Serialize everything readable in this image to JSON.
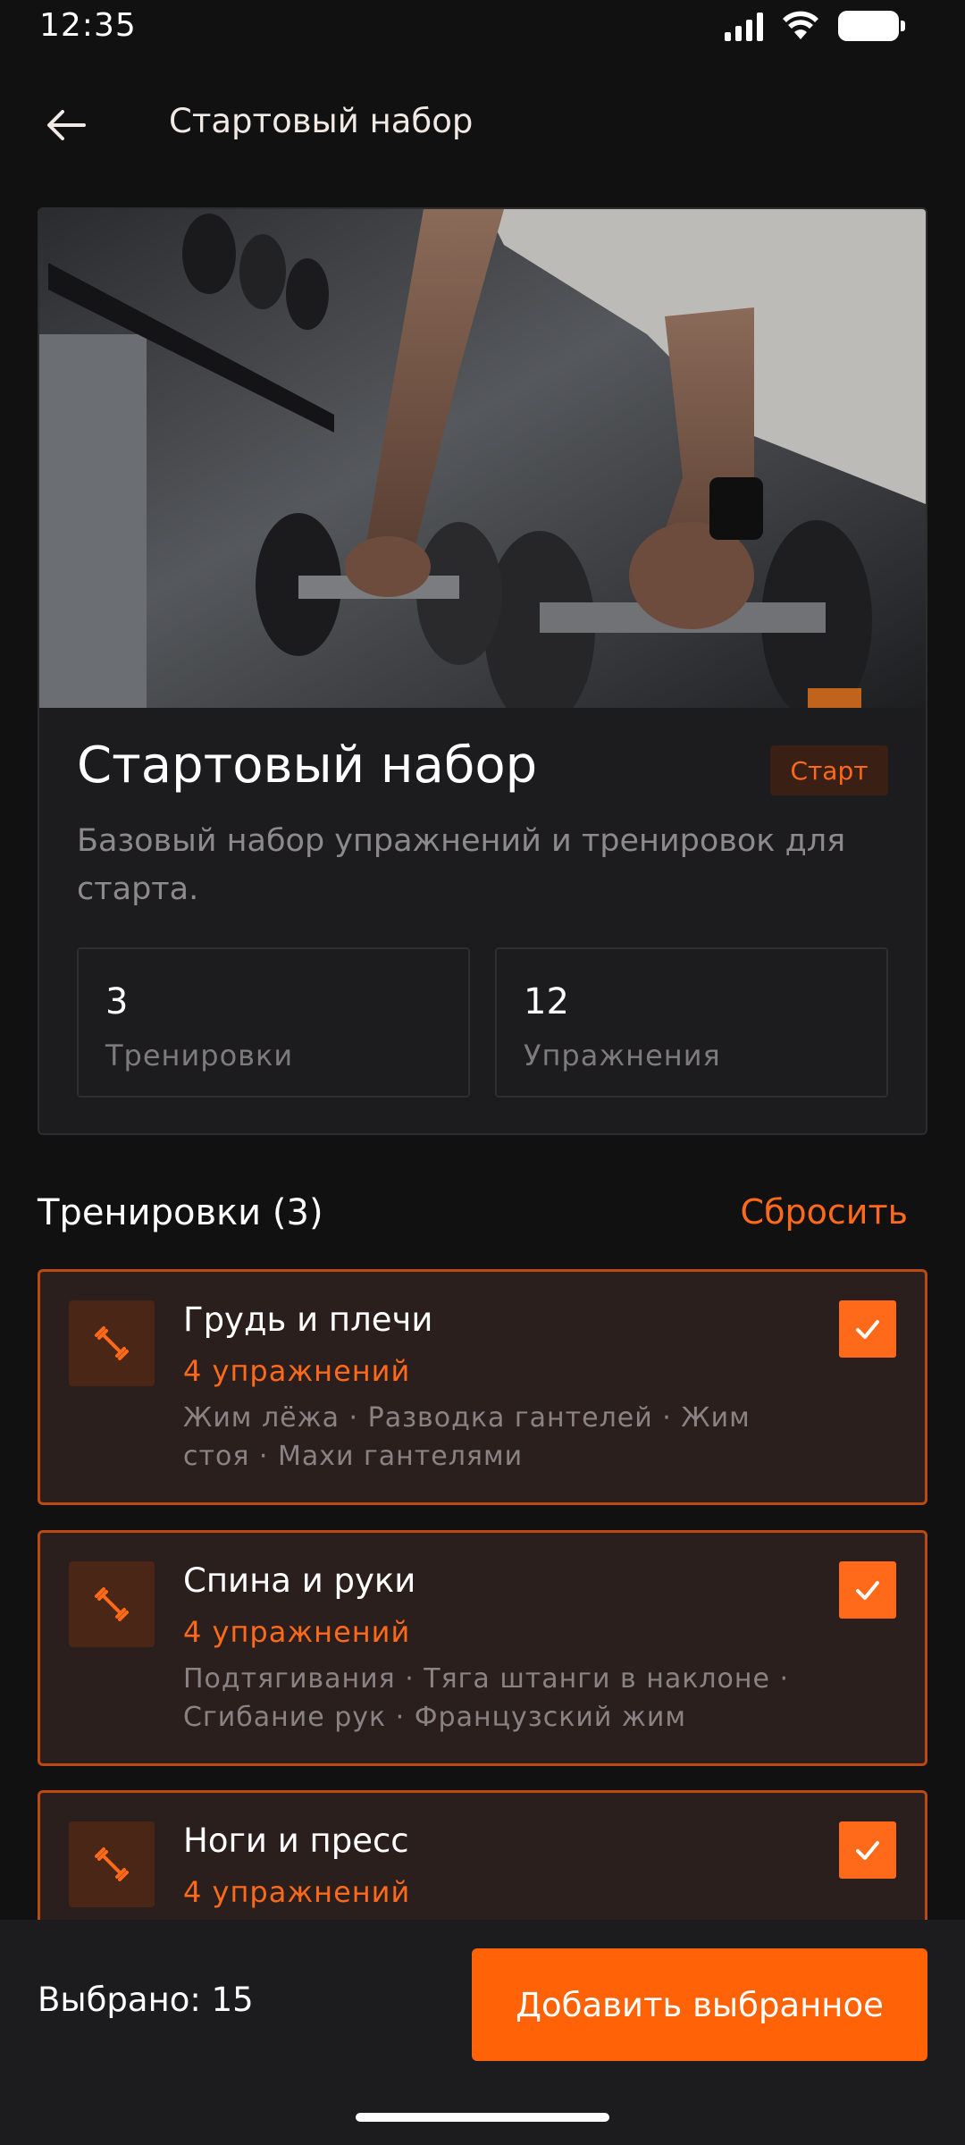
{
  "status_bar": {
    "time": "12:35"
  },
  "app_bar": {
    "title": "Стартовый набор"
  },
  "hero": {
    "image_alt": "dumbbell-rack-photo",
    "title": "Стартовый набор",
    "badge": "Старт",
    "description": "Базовый набор упражнений и тренировок для старта.",
    "stats": [
      {
        "value": "3",
        "label": "Тренировки"
      },
      {
        "value": "12",
        "label": "Упражнения"
      }
    ]
  },
  "section": {
    "title": "Тренировки (3)",
    "reset_label": "Сбросить"
  },
  "workouts": [
    {
      "title": "Грудь и плечи",
      "count": "4 упражнений",
      "exercises": "Жим лёжа · Разводка гантелей · Жим стоя · Махи гантелями",
      "checked": true
    },
    {
      "title": "Спина и руки",
      "count": "4 упражнений",
      "exercises": "Подтягивания · Тяга штанги в наклоне · Сгибание рук · Французский жим",
      "checked": true
    },
    {
      "title": "Ноги и пресс",
      "count": "4 упражнений",
      "exercises": "",
      "checked": true
    }
  ],
  "bottom_bar": {
    "selected": "Выбрано: 15",
    "add_label": "Добавить выбранное"
  },
  "colors": {
    "accent": "#ff6a1a",
    "background": "#121112",
    "card": "#1c1b1d"
  },
  "icons": [
    "back-arrow-icon",
    "dumbbell-icon",
    "check-icon",
    "signal-icon",
    "wifi-icon",
    "battery-icon"
  ]
}
